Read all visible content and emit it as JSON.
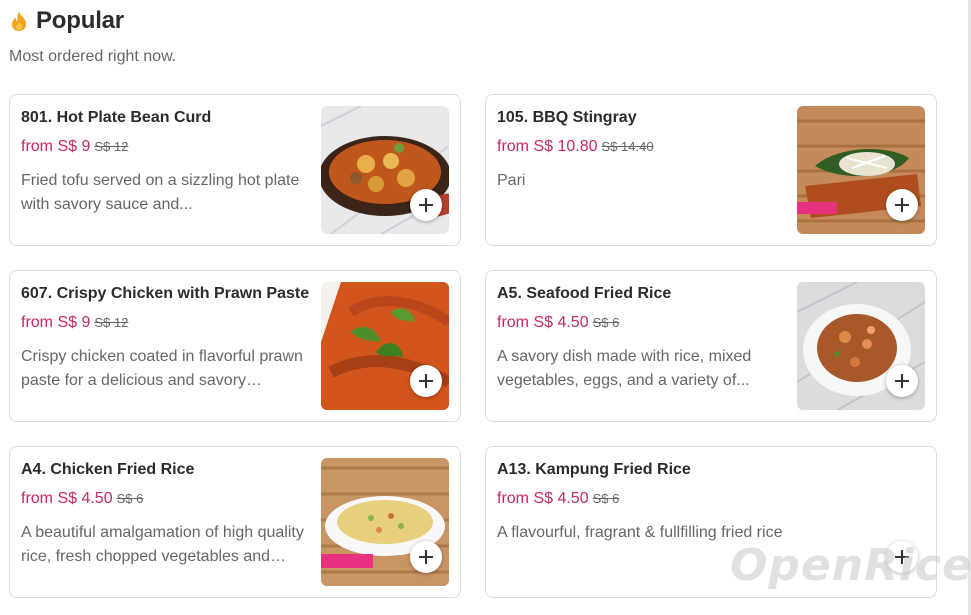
{
  "section": {
    "title": "Popular",
    "subtitle": "Most ordered right now.",
    "icon": "flame-icon"
  },
  "items": [
    {
      "name": "801. Hot Plate Bean Curd",
      "price": "from S$ 9",
      "old_price": "S$ 12",
      "description": "Fried tofu served on a sizzling hot plate with savory sauce and...",
      "has_photo": true
    },
    {
      "name": "105. BBQ Stingray",
      "price": "from S$ 10.80",
      "old_price": "S$ 14.40",
      "description": "Pari",
      "has_photo": true
    },
    {
      "name": "607. Crispy Chicken with Prawn Paste",
      "price": "from S$ 9",
      "old_price": "S$ 12",
      "description": "Crispy chicken coated in flavorful prawn paste for a delicious and savory experience",
      "has_photo": true
    },
    {
      "name": "A5. Seafood Fried Rice",
      "price": "from S$ 4.50",
      "old_price": "S$ 6",
      "description": "A savory dish made with rice, mixed vegetables, eggs, and a variety of...",
      "has_photo": true
    },
    {
      "name": "A4. Chicken Fried Rice",
      "price": "from S$ 4.50",
      "old_price": "S$ 6",
      "description": "A beautiful amalgamation of high quality rice, fresh chopped vegetables and chicken",
      "has_photo": true
    },
    {
      "name": "A13. Kampung Fried Rice",
      "price": "from S$ 4.50",
      "old_price": "S$ 6",
      "description": "A flavourful, fragrant & fullfilling fried rice",
      "has_photo": false
    }
  ],
  "watermark": "OpenRice",
  "colors": {
    "price": "#c4286a",
    "flame": "#f3a41b",
    "card_border": "#dcdcdc"
  }
}
